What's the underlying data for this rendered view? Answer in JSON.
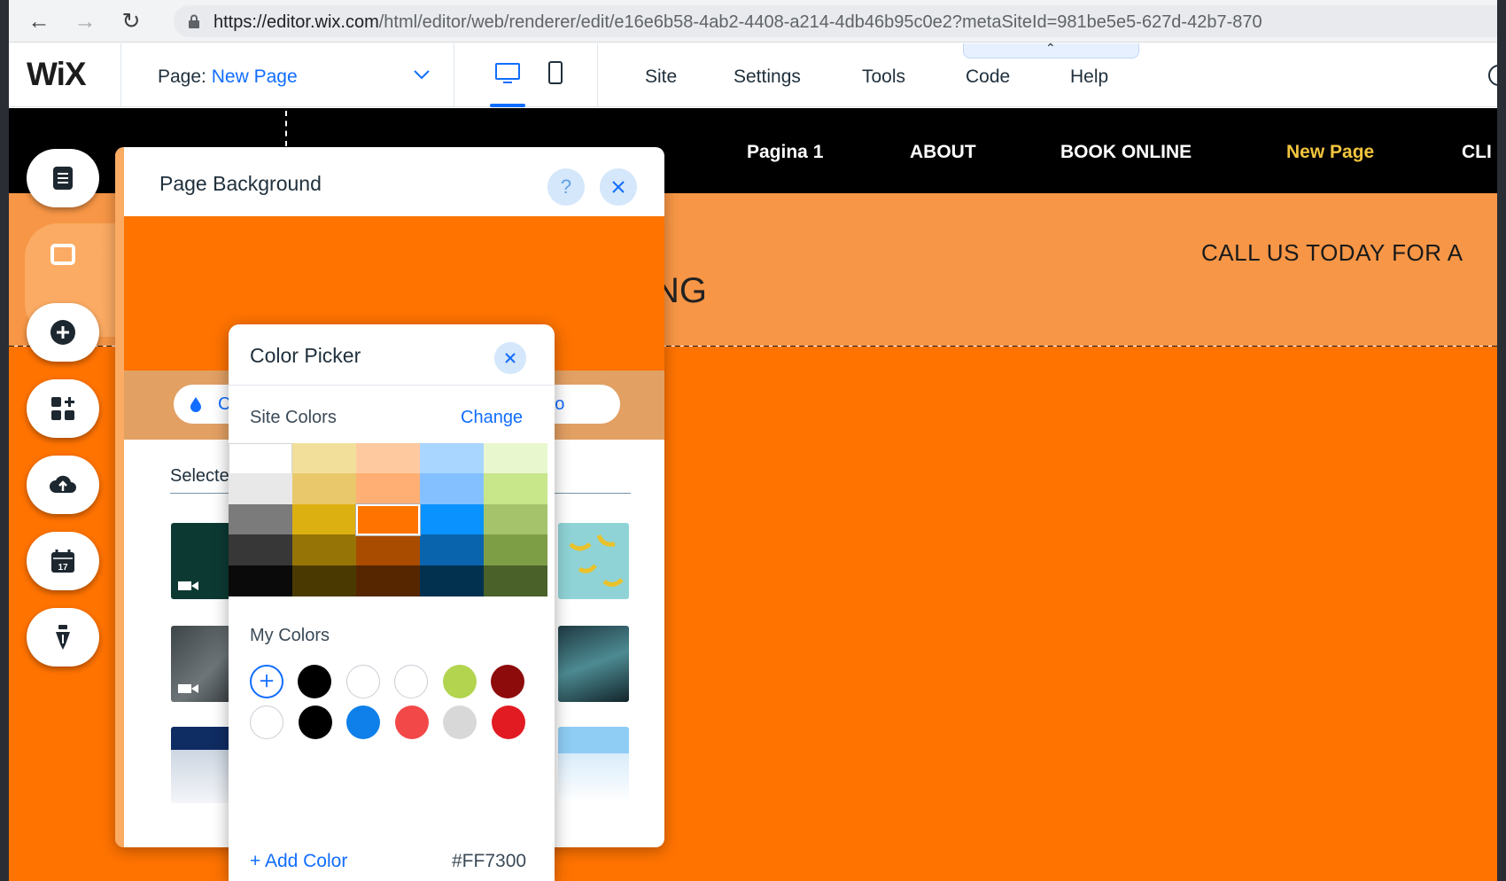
{
  "browser": {
    "url_host": "https://editor.wix.com",
    "url_path": "/html/editor/web/renderer/edit/e16e6b58-4ab2-4408-a214-4db46b95c0e2?metaSiteId=981be5e5-627d-42b7-870"
  },
  "editor": {
    "logo": "WiX",
    "page_prefix": "Page:",
    "page_name": "New Page",
    "menu": [
      "Site",
      "Settings",
      "Tools",
      "Code",
      "Help"
    ]
  },
  "site": {
    "nav": [
      "Pagina 1",
      "ABOUT",
      "BOOK ONLINE",
      "New Page",
      "CLI"
    ],
    "call_us": "CALL US TODAY FOR A",
    "band_text": "NG",
    "body_color": "#FF7300"
  },
  "bg_panel": {
    "title": "Page Background",
    "help": "?",
    "tab_color": "C",
    "tab_video": "deo",
    "selected": "Selecte"
  },
  "color_picker": {
    "title": "Color Picker",
    "site_colors_label": "Site Colors",
    "change": "Change",
    "grid": [
      [
        "#FFFFFF",
        "#F2E09A",
        "#FFC9A0",
        "#A9D6FF",
        "#E9F7CF"
      ],
      [
        "#E8E8E8",
        "#E8C86A",
        "#FFAF73",
        "#84C0FF",
        "#C8E68A"
      ],
      [
        "#7B7B7B",
        "#DDB012",
        "#FF7300",
        "#0A93FF",
        "#A4C36B"
      ],
      [
        "#373737",
        "#967506",
        "#AA4C00",
        "#0A64AD",
        "#7E9E45"
      ],
      [
        "#0A0A0A",
        "#4A3A02",
        "#552600",
        "#02314F",
        "#4A6129"
      ]
    ],
    "selected_cell": [
      2,
      2
    ],
    "my_colors_label": "My Colors",
    "my_colors_row1": [
      "#000000",
      "#FFFFFF",
      "#FFFFFF",
      "#B2D44F",
      "#8E0B0B"
    ],
    "my_colors_row2": [
      "#FFFFFF",
      "#000000",
      "#0F7FEA",
      "#F24848",
      "#D8D8D8",
      "#E21B23"
    ],
    "add_color": "+ Add Color",
    "hex": "#FF7300"
  }
}
